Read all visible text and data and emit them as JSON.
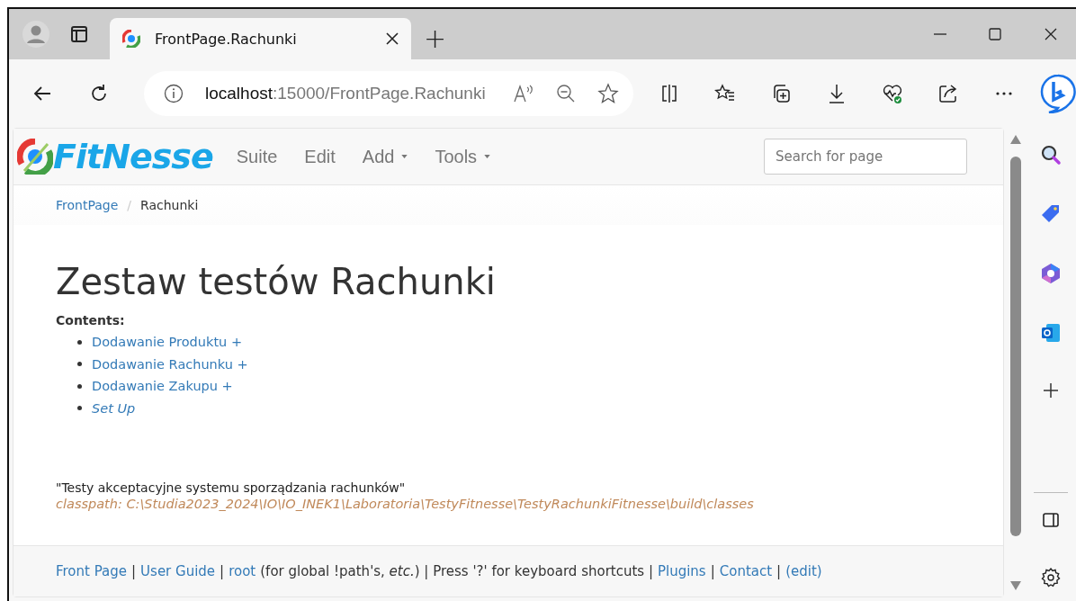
{
  "browser": {
    "tabs": [
      {
        "title": "FrontPage.Rachunki",
        "selected": true
      }
    ],
    "new_tab": "+",
    "address": {
      "host": "localhost",
      "rest": ":15000/FrontPage.Rachunki"
    }
  },
  "fitnesse": {
    "logo": "FitNesse",
    "nav": [
      {
        "label": "Suite",
        "dropdown": false
      },
      {
        "label": "Edit",
        "dropdown": false
      },
      {
        "label": "Add",
        "dropdown": true
      },
      {
        "label": "Tools",
        "dropdown": true
      }
    ],
    "search": {
      "placeholder": "Search for page"
    },
    "breadcrumb_separator": "/",
    "breadcrumb": [
      {
        "label": "FrontPage",
        "kind": "link"
      },
      {
        "label": "Rachunki",
        "kind": "current"
      }
    ],
    "title": "Zestaw testów Rachunki",
    "contents_label": "Contents:",
    "contents": [
      {
        "label": "Dodawanie Produktu +",
        "kind": "suite"
      },
      {
        "label": "Dodawanie Rachunku +",
        "kind": "suite"
      },
      {
        "label": "Dodawanie Zakupu +",
        "kind": "suite"
      },
      {
        "label": "Set Up",
        "kind": "special"
      }
    ],
    "description": "\"Testy akceptacyjne systemu sporządzania rachunków\"",
    "classpath": "classpath: C:\\Studia2023_2024\\IO\\IO_INEK1\\Laboratoria\\TestyFitnesse\\TestyRachunkiFitnesse\\build\\classes",
    "footer": [
      {
        "text": "Front Page",
        "kind": "link"
      },
      {
        "text": "|",
        "kind": "text"
      },
      {
        "text": "User Guide",
        "kind": "link"
      },
      {
        "text": "|",
        "kind": "text"
      },
      {
        "text": "root",
        "kind": "link"
      },
      {
        "text": "(for global !path's, *etc.*) | Press '?' for keyboard shortcuts |",
        "kind": "text"
      },
      {
        "text": "Plugins",
        "kind": "link"
      },
      {
        "text": "|",
        "kind": "text"
      },
      {
        "text": "Contact",
        "kind": "link"
      },
      {
        "text": "|",
        "kind": "text"
      },
      {
        "text": "(edit)",
        "kind": "link"
      }
    ]
  }
}
